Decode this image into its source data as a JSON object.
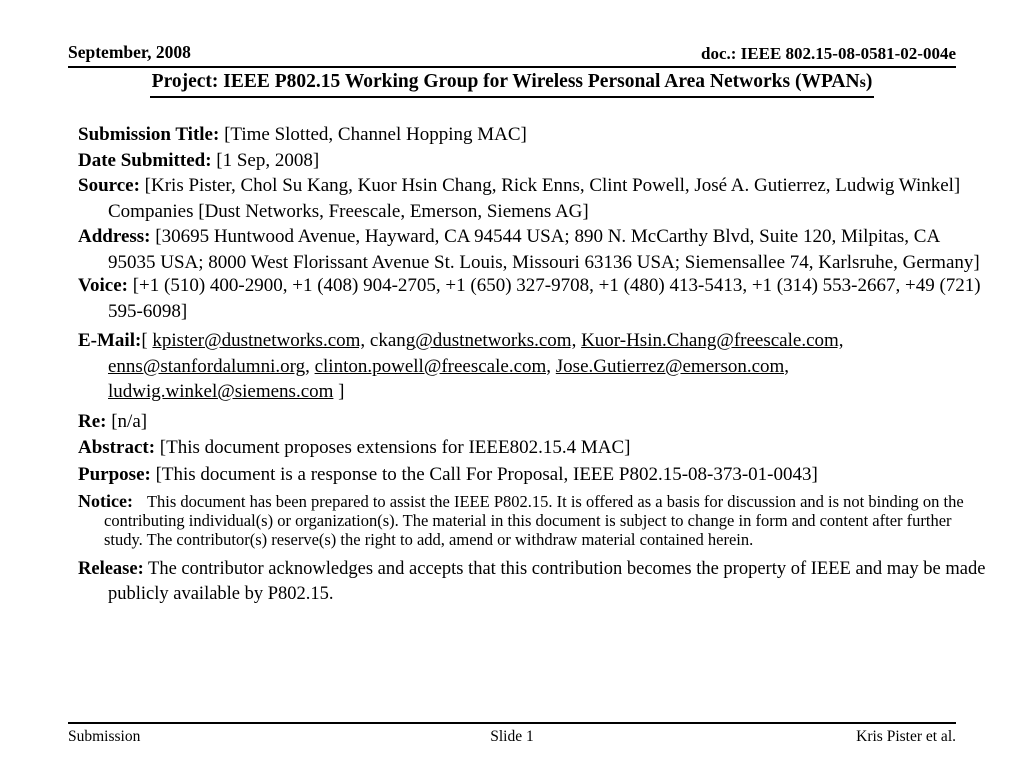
{
  "header": {
    "date": "September, 2008",
    "doc_number": "doc.: IEEE 802.15-08-0581-02-004e",
    "project_title_main": "Project: IEEE P802.15 Working Group for Wireless Personal Area Networks (WPAN",
    "project_title_smallcap": "s",
    "project_title_close": ")"
  },
  "fields": {
    "submission_title_label": "Submission Title:",
    "submission_title_value": "[Time Slotted, Channel Hopping MAC]",
    "date_submitted_label": "Date Submitted:",
    "date_submitted_value": "[1 Sep, 2008]",
    "source_label": "Source:",
    "source_value": "[Kris Pister, Chol Su Kang, Kuor Hsin Chang, Rick Enns, Clint Powell, José A. Gutierrez, Ludwig Winkel] Companies [Dust Networks, Freescale, Emerson, Siemens AG]",
    "address_label": "Address:",
    "address_value": "[30695 Huntwood Avenue, Hayward, CA 94544 USA; 890 N. McCarthy Blvd, Suite 120, Milpitas, CA 95035 USA; 8000 West Florissant Avenue St. Louis, Missouri 63136 USA; Siemensallee 74, Karlsruhe, Germany]",
    "voice_label": "Voice:",
    "voice_value": "[+1 (510) 400-2900, +1 (408) 904-2705, +1 (650) 327-9708, +1 (480) 413-5413, +1 (314) 553-2667,  +49 (721) 595-6098]",
    "email_label": "E-Mail:",
    "email_open_bracket": "[ ",
    "email_close_bracket": " ]",
    "emails": [
      "kpister@dustnetworks.com,",
      "ckang",
      "@dustnetworks.com,",
      "Kuor-Hsin.Chang@freescale.com,",
      "enns@stanfordalumni.org,",
      "clinton.powell@freescale.com,",
      "Jose.Gutierrez@emerson.com,",
      "ludwig.winkel@siemens.com"
    ],
    "re_label": "Re:",
    "re_value": "[n/a]",
    "abstract_label": "Abstract:",
    "abstract_value": "[This document proposes extensions for IEEE802.15.4 MAC]",
    "purpose_label": "Purpose:",
    "purpose_value": "[This document is a response to the Call For Proposal, IEEE P802.15-08-373-01-0043]",
    "notice_label": "Notice:",
    "notice_value": "This document has been prepared to assist the IEEE P802.15.  It is offered as a basis for discussion and is not binding on the contributing individual(s) or organization(s). The material in this document is subject to change in form and content after further study. The contributor(s) reserve(s) the right to add, amend or withdraw material contained herein.",
    "release_label": "Release:",
    "release_value": "The contributor acknowledges and accepts that this contribution becomes the property of IEEE and may be made publicly available by P802.15."
  },
  "footer": {
    "left": "Submission",
    "center": "Slide 1",
    "right": "Kris Pister et al."
  }
}
